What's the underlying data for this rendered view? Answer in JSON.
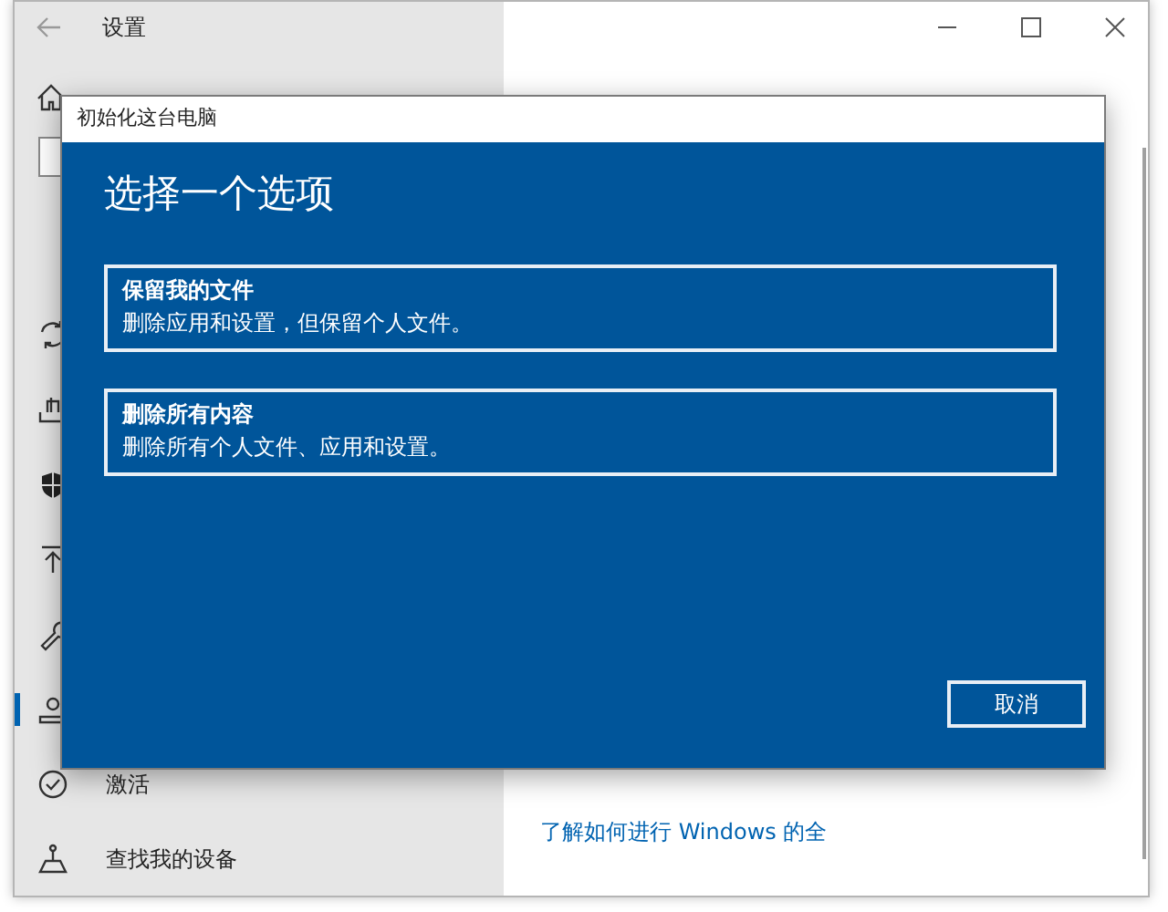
{
  "settings_window": {
    "title": "设置"
  },
  "sidebar": {
    "items": [
      {
        "selected": false
      },
      {
        "selected": false
      },
      {
        "selected": false
      },
      {
        "selected": false
      },
      {
        "selected": false
      },
      {
        "selected": true
      },
      {
        "label": "激活",
        "selected": false
      },
      {
        "label": "查找我的设备",
        "selected": false
      }
    ]
  },
  "main": {
    "link": "了解如何进行 Windows 的全"
  },
  "dialog": {
    "title": "初始化这台电脑",
    "heading": "选择一个选项",
    "options": [
      {
        "title": "保留我的文件",
        "description": "删除应用和设置，但保留个人文件。"
      },
      {
        "title": "删除所有内容",
        "description": "删除所有个人文件、应用和设置。"
      }
    ],
    "cancel": "取消"
  }
}
